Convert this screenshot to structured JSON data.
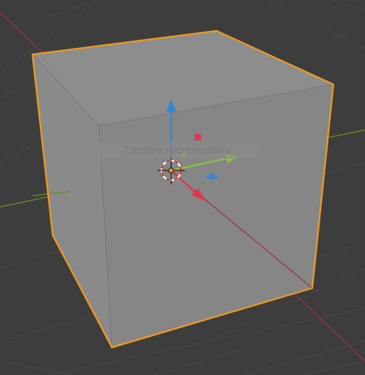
{
  "app": {
    "tooltip": "Capture rectangulaire"
  },
  "viewport": {
    "background_color": "#3d3d3d",
    "grid_color": "#474747",
    "x_axis_color": "#9b3443",
    "y_axis_color": "#6a8c2a",
    "selection_outline_color": "#f39a1a"
  },
  "gizmo": {
    "x_color": "#e2344a",
    "y_color": "#8bc43a",
    "z_color": "#2f88d8"
  },
  "object": {
    "face_front_color": "#868686",
    "face_top_color": "#8c8c8c",
    "face_side_color": "#8a8a8a"
  }
}
